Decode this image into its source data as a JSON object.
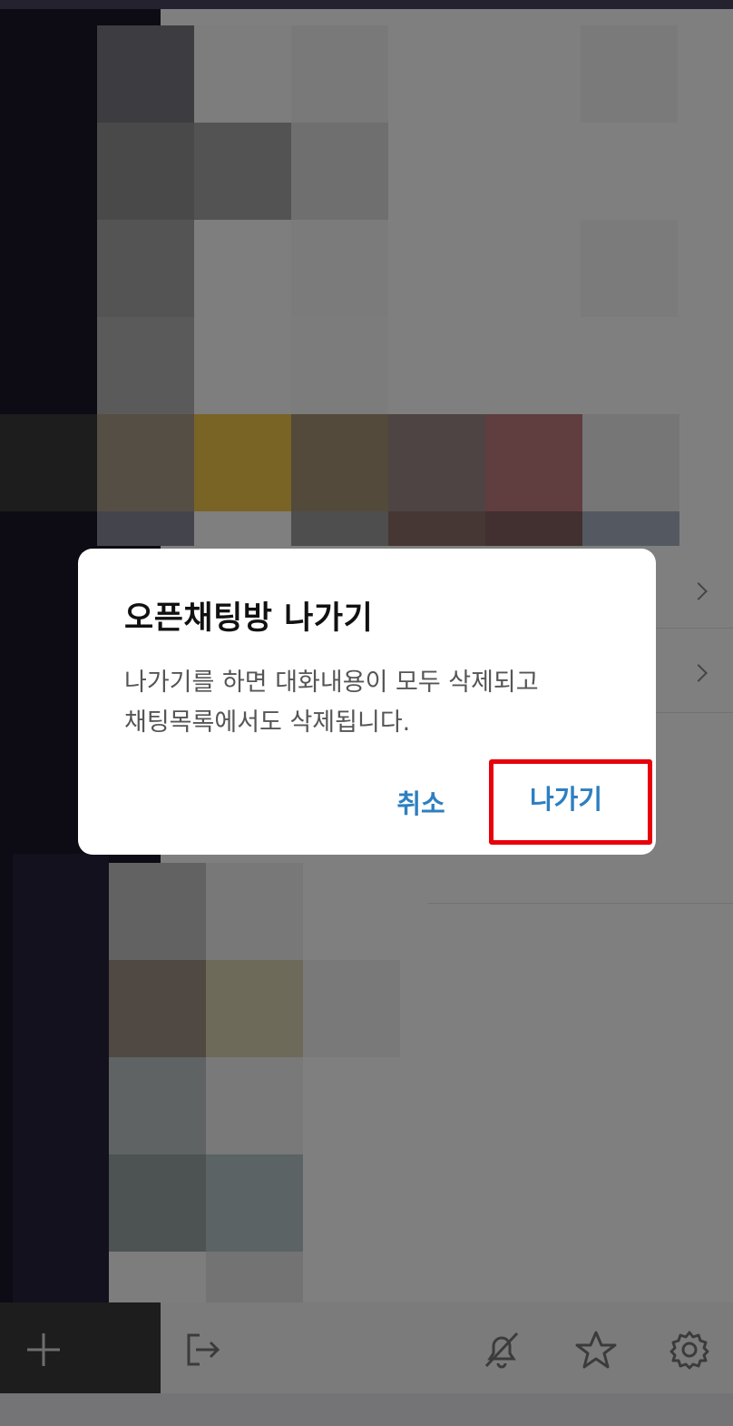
{
  "dialog": {
    "title": "오픈채팅방 나가기",
    "message_line1": "나가기를 하면 대화내용이 모두 삭제되고",
    "message_line2": "채팅목록에서도 삭제됩니다.",
    "cancel_label": "취소",
    "leave_label": "나가기"
  },
  "colors": {
    "accent": "#2d7fc1",
    "highlight": "#e8000b"
  },
  "icons": {
    "add": "plus-icon",
    "exit": "exit-icon",
    "notifications_off": "bell-off-icon",
    "favorite": "star-icon",
    "settings": "gear-icon"
  }
}
